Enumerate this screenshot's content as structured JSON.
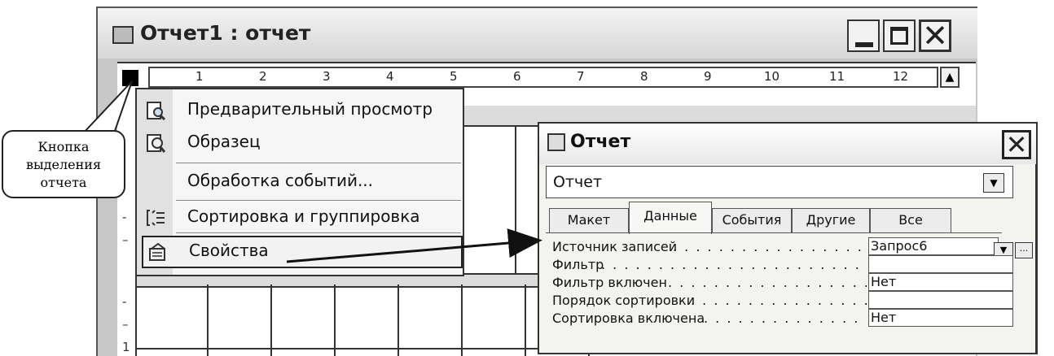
{
  "report_window": {
    "title": "Отчет1 : отчет",
    "minimize_label": "",
    "close_label": "✕"
  },
  "ruler": {
    "numbers": [
      "1",
      "2",
      "3",
      "4",
      "5",
      "6",
      "7",
      "8",
      "9",
      "10",
      "11",
      "12"
    ],
    "vertical_marks": [
      "-",
      "–",
      "-",
      "1"
    ]
  },
  "context_menu": {
    "items": [
      {
        "label": "Предварительный просмотр",
        "icon": "print-preview-icon"
      },
      {
        "label": "Образец",
        "icon": "sample-preview-icon"
      },
      {
        "label": "Обработка событий...",
        "icon": ""
      },
      {
        "label": "Сортировка и группировка",
        "icon": "sorting-grouping-icon"
      },
      {
        "label": "Свойства",
        "icon": "properties-icon"
      }
    ]
  },
  "callout": {
    "line1": "Кнопка",
    "line2": "выделения",
    "line3": "отчета"
  },
  "property_sheet": {
    "title": "Отчет",
    "object_selector": "Отчет",
    "tabs": [
      "Макет",
      "Данные",
      "События",
      "Другие",
      "Все"
    ],
    "active_tab": "Данные",
    "properties": [
      {
        "label": "Источник записей",
        "value": "Запрос6"
      },
      {
        "label": "Фильтр",
        "value": ""
      },
      {
        "label": "Фильтр включен",
        "value": "Нет"
      },
      {
        "label": "Порядок сортировки",
        "value": ""
      },
      {
        "label": "Сортировка включена",
        "value": "Нет"
      }
    ],
    "dropdown_glyph": "▼",
    "builder_glyph": "..."
  }
}
